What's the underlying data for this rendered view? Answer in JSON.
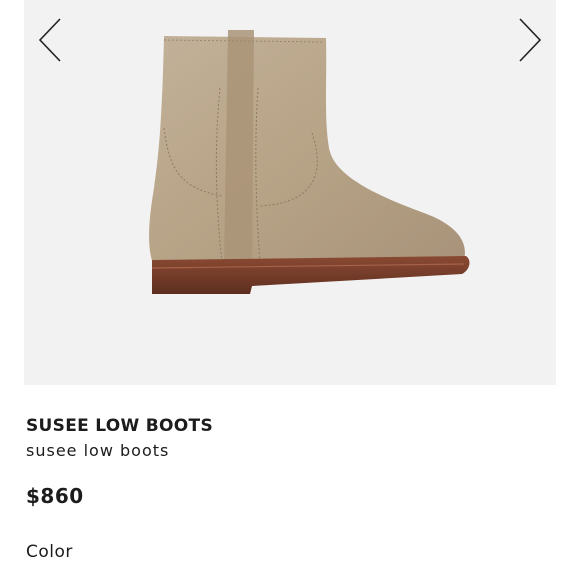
{
  "product": {
    "name": "SUSEE LOW BOOTS",
    "subtitle": "susee low boots",
    "price": "$860",
    "color_label": "Color"
  },
  "gallery": {
    "prev_icon": "chevron-left-icon",
    "next_icon": "chevron-right-icon",
    "image_subject": "suede ankle boot"
  },
  "colors": {
    "gallery_background": "#f2f2f2",
    "suede": "#b9a68d",
    "sole": "#7a3f2c",
    "text": "#1c1c1c"
  }
}
